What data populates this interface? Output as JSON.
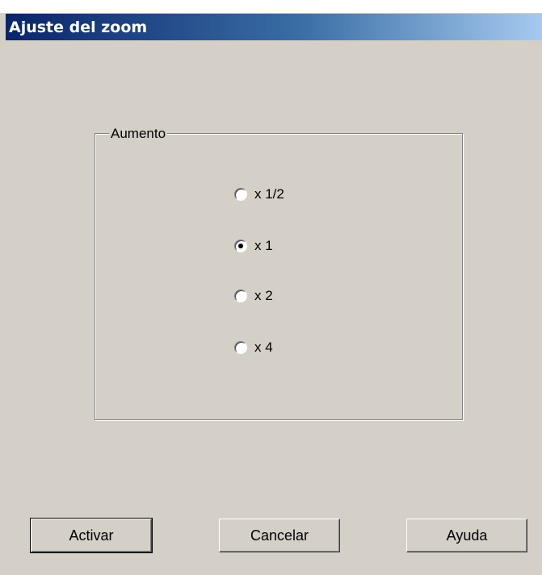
{
  "window": {
    "title": "Ajuste del zoom"
  },
  "group": {
    "label": "Aumento",
    "options": [
      {
        "label": "x 1/2",
        "selected": false
      },
      {
        "label": "x 1",
        "selected": true
      },
      {
        "label": "x 2",
        "selected": false
      },
      {
        "label": "x 4",
        "selected": false
      }
    ]
  },
  "buttons": {
    "activate": "Activar",
    "cancel": "Cancelar",
    "help": "Ayuda"
  },
  "colors": {
    "face": "#d4d0c8",
    "title_start": "#0a246a",
    "title_end": "#a6caf0"
  }
}
